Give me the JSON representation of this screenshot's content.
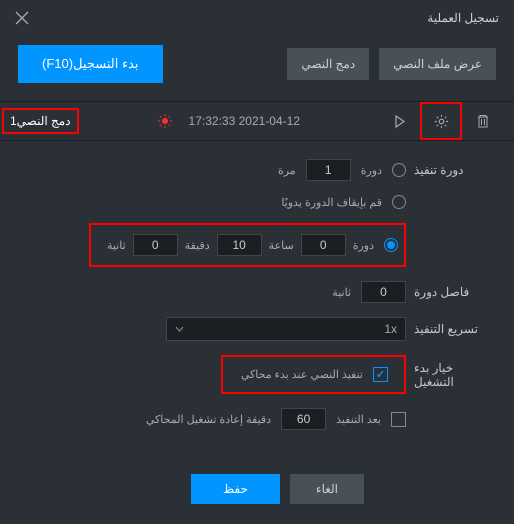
{
  "title": "تسجيل العملية",
  "top_buttons": {
    "view_file": "عرض ملف النصي",
    "merge": "دمج النصي",
    "start_rec": "بدء التسجيل(F10)"
  },
  "script": {
    "name": "دمج النصي1",
    "timestamp": "2021-04-12 17:32:33"
  },
  "labels": {
    "loop": "دورة تنفيذ",
    "interval": "فاصل دورة",
    "speed": "تسريع التنفيذ",
    "startup": "خيار بدء التشغيل"
  },
  "loop": {
    "times_val": "1",
    "times_unit": "مرة",
    "times_lbl": "دورة",
    "manual": "قم بإيقاف الدورة يدويًا",
    "dur_lbl": "دورة",
    "hour": "0",
    "hour_u": "ساعة",
    "minute": "10",
    "minute_u": "دقيقة",
    "second": "0",
    "second_u": "ثانية"
  },
  "interval": {
    "val": "0",
    "unit": "ثانية"
  },
  "speed": {
    "val": "1x"
  },
  "startup": {
    "opt": "تنفيذ النصي عند بدء محاكي"
  },
  "restart": {
    "txt1": "دقيقة إعادة تشغيل المحاكي",
    "val": "60",
    "txt2": "بعد التنفيذ"
  },
  "footer": {
    "save": "حفظ",
    "cancel": "الغاء"
  }
}
